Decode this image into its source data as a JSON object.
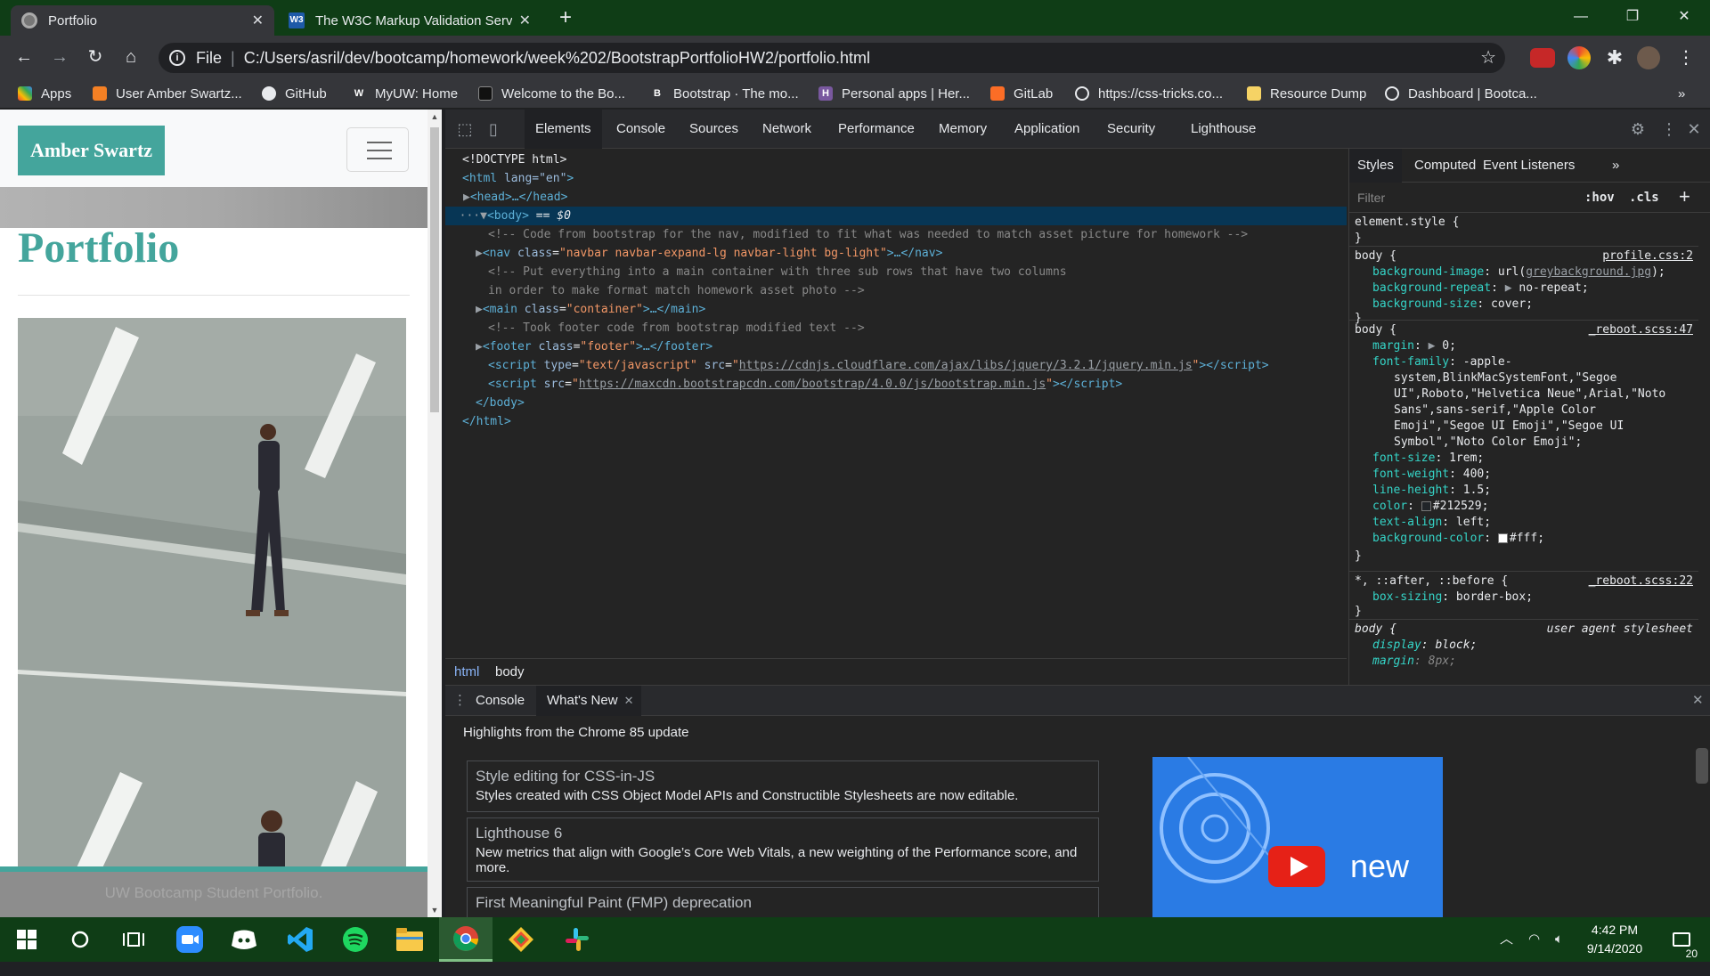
{
  "browser": {
    "tabs": [
      {
        "title": "Portfolio",
        "active": true
      },
      {
        "title": "The W3C Markup Validation Serv",
        "active": false
      }
    ],
    "address": {
      "scheme_label": "File",
      "url": "C:/Users/asril/dev/bootcamp/homework/week%202/BootstrapPortfolioHW2/portfolio.html"
    },
    "bookmarks": [
      {
        "label": "Apps",
        "icon": "apps-grid-icon"
      },
      {
        "label": "User Amber Swartz...",
        "icon": "stackoverflow-icon"
      },
      {
        "label": "GitHub",
        "icon": "github-icon"
      },
      {
        "label": "MyUW: Home",
        "icon": "uw-icon"
      },
      {
        "label": "Welcome to the Bo...",
        "icon": "book-icon"
      },
      {
        "label": "Bootstrap · The mo...",
        "icon": "bootstrap-icon"
      },
      {
        "label": "Personal apps | Her...",
        "icon": "heroku-icon"
      },
      {
        "label": "GitLab",
        "icon": "gitlab-icon"
      },
      {
        "label": "https://css-tricks.co...",
        "icon": "globe-icon"
      },
      {
        "label": "Resource Dump",
        "icon": "folder-icon"
      },
      {
        "label": "Dashboard | Bootca...",
        "icon": "globe-icon"
      }
    ]
  },
  "site": {
    "brand": "Amber Swartz",
    "heading": "Portfolio",
    "footer_text": "UW Bootcamp Student Portfolio."
  },
  "devtools": {
    "tabs": [
      "Elements",
      "Console",
      "Sources",
      "Network",
      "Performance",
      "Memory",
      "Application",
      "Security",
      "Lighthouse"
    ],
    "selected_tab": "Elements",
    "dom": {
      "doctype": "<!DOCTYPE html>",
      "html_open": "lang=\"en\"",
      "head": "<head>…</head>",
      "body_marker": "== $0",
      "comment1": "<!-- Code from bootstrap for the nav, modified to fit what was needed to match asset picture for homework -->",
      "nav_class": "navbar navbar-expand-lg navbar-light bg-light",
      "comment2a": "<!-- Put everything into a main container with three sub rows that have two columns",
      "comment2b": "in order to make format match homework asset photo -->",
      "main_class": "container",
      "comment3": "<!-- Took footer code from bootstrap modified text -->",
      "footer_class": "footer",
      "script1_type": "text/javascript",
      "script1_src": "https://cdnjs.cloudflare.com/ajax/libs/jquery/3.2.1/jquery.min.js",
      "script2_src": "https://maxcdn.bootstrapcdn.com/bootstrap/4.0.0/js/bootstrap.min.js"
    },
    "breadcrumbs": [
      "html",
      "body"
    ],
    "styles": {
      "tabs": [
        "Styles",
        "Computed",
        "Event Listeners"
      ],
      "filter_placeholder": "Filter",
      "hov": ":hov",
      "cls": ".cls",
      "src_profile": "profile.css:2",
      "src_reboot47": "_reboot.scss:47",
      "src_reboot22": "_reboot.scss:22",
      "ua_label": "user agent stylesheet",
      "bg_image_value": "greybackground.jpg",
      "font_family_lines": [
        "-apple-",
        "system,BlinkMacSystemFont,\"Segoe",
        "UI\",Roboto,\"Helvetica Neue\",Arial,\"Noto",
        "Sans\",sans-serif,\"Apple Color",
        "Emoji\",\"Segoe UI Emoji\",\"Segoe UI",
        "Symbol\",\"Noto Color Emoji\";"
      ],
      "color_value": "#212529",
      "bg_color_value": "#fff"
    },
    "drawer": {
      "tabs": [
        "Console",
        "What's New"
      ],
      "heading": "Highlights from the Chrome 85 update",
      "cards": [
        {
          "title": "Style editing for CSS-in-JS",
          "desc": "Styles created with CSS Object Model APIs and Constructible Stylesheets are now editable."
        },
        {
          "title": "Lighthouse 6",
          "desc": "New metrics that align with Google’s Core Web Vitals, a new weighting of the Performance score, and more."
        },
        {
          "title": "First Meaningful Paint (FMP) deprecation",
          "desc": ""
        }
      ],
      "video_text": "new"
    }
  },
  "taskbar": {
    "apps": [
      "windows-start-icon",
      "cortana-search-icon",
      "task-view-icon",
      "zoom-icon",
      "discord-icon",
      "vscode-icon",
      "spotify-icon",
      "file-explorer-icon",
      "chrome-icon",
      "git-icon",
      "slack-icon"
    ],
    "time": "4:42 PM",
    "date": "9/14/2020",
    "notifications": "20"
  }
}
